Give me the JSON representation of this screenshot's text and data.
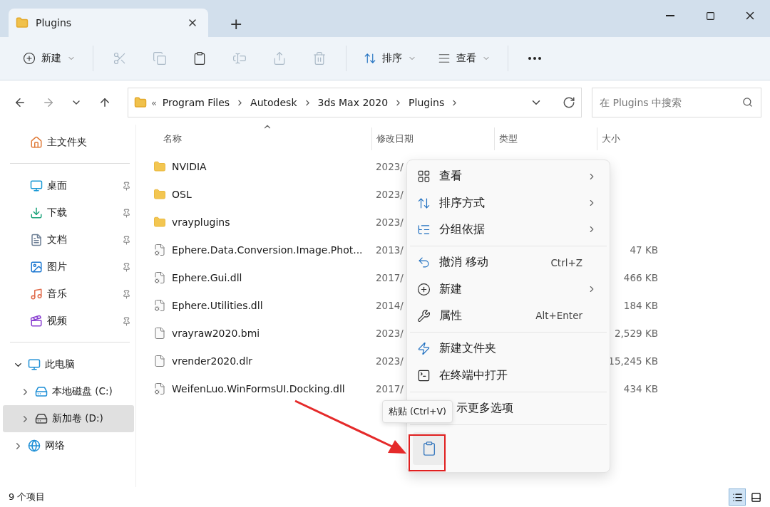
{
  "window": {
    "tab_title": "Plugins",
    "new_tab": "+"
  },
  "toolbar": {
    "new_label": "新建",
    "tools": [
      {
        "kind": "cut",
        "disabled": true
      },
      {
        "kind": "copy",
        "disabled": true
      },
      {
        "kind": "paste",
        "disabled": false
      },
      {
        "kind": "rename",
        "disabled": true
      },
      {
        "kind": "share",
        "disabled": true
      },
      {
        "kind": "delete",
        "disabled": true
      }
    ],
    "sort_label": "排序",
    "view_label": "查看"
  },
  "address": {
    "overflow": "«",
    "path": [
      "Program Files",
      "Autodesk",
      "3ds Max 2020",
      "Plugins"
    ]
  },
  "search": {
    "placeholder": "在 Plugins 中搜索"
  },
  "sidebar": {
    "home": "主文件夹",
    "quick_access": [
      {
        "kind": "desktop",
        "label": "桌面"
      },
      {
        "kind": "downloads",
        "label": "下载"
      },
      {
        "kind": "documents",
        "label": "文档"
      },
      {
        "kind": "pictures",
        "label": "图片"
      },
      {
        "kind": "music",
        "label": "音乐"
      },
      {
        "kind": "videos",
        "label": "视频"
      }
    ],
    "tree": [
      {
        "kind": "pc",
        "label": "此电脑",
        "expanded": true,
        "selected": false,
        "children": [
          {
            "kind": "system-drive",
            "label": "本地磁盘 (C:)",
            "expanded": false,
            "selected": false
          },
          {
            "kind": "drive",
            "label": "新加卷 (D:)",
            "expanded": false,
            "selected": true
          }
        ]
      },
      {
        "kind": "network",
        "label": "网络",
        "expanded": false,
        "selected": false
      }
    ]
  },
  "columns": [
    {
      "label": "名称",
      "sorted": true
    },
    {
      "label": "修改日期",
      "sorted": false
    },
    {
      "label": "类型",
      "sorted": false
    },
    {
      "label": "大小",
      "sorted": false
    }
  ],
  "files": [
    {
      "kind": "folder",
      "name": "NVIDIA",
      "date": "2023/"
    },
    {
      "kind": "folder",
      "name": "OSL",
      "date": "2023/"
    },
    {
      "kind": "folder",
      "name": "vrayplugins",
      "date": "2023/"
    },
    {
      "kind": "dll",
      "name": "Ephere.Data.Conversion.Image.Phot...",
      "date": "2013/",
      "size": "47 KB"
    },
    {
      "kind": "dll",
      "name": "Ephere.Gui.dll",
      "date": "2017/",
      "size": "466 KB"
    },
    {
      "kind": "dll",
      "name": "Ephere.Utilities.dll",
      "date": "2014/",
      "size": "184 KB"
    },
    {
      "kind": "file",
      "name": "vrayraw2020.bmi",
      "date": "2023/",
      "size": "2,529 KB"
    },
    {
      "kind": "file",
      "name": "vrender2020.dlr",
      "date": "2023/",
      "size": "15,245 KB"
    },
    {
      "kind": "dll",
      "name": "WeifenLuo.WinFormsUI.Docking.dll",
      "date": "2017/",
      "size": "434 KB"
    }
  ],
  "context_menu": {
    "items": [
      {
        "kind": "view",
        "label": "查看",
        "submenu": true
      },
      {
        "kind": "sort",
        "label": "排序方式",
        "submenu": true
      },
      {
        "kind": "group",
        "label": "分组依据",
        "submenu": true
      },
      {
        "kind": "separator"
      },
      {
        "kind": "undo",
        "label": "撤消 移动",
        "shortcut": "Ctrl+Z",
        "submenu": false
      },
      {
        "kind": "new",
        "label": "新建",
        "submenu": true
      },
      {
        "kind": "properties",
        "label": "属性",
        "shortcut": "Alt+Enter",
        "submenu": false
      },
      {
        "kind": "separator"
      },
      {
        "kind": "new-folder",
        "label": "新建文件夹",
        "submenu": false
      },
      {
        "kind": "terminal",
        "label": "在终端中打开",
        "submenu": false
      },
      {
        "kind": "separator"
      },
      {
        "kind": "more",
        "label": "示更多选项",
        "submenu": false
      },
      {
        "kind": "separator"
      }
    ],
    "paste_tooltip": "粘贴 (Ctrl+V)",
    "paste_highlighted": true
  },
  "status_bar": {
    "count": "9 个项目",
    "views": [
      {
        "kind": "details",
        "selected": true
      },
      {
        "kind": "tiles",
        "selected": false
      }
    ]
  }
}
